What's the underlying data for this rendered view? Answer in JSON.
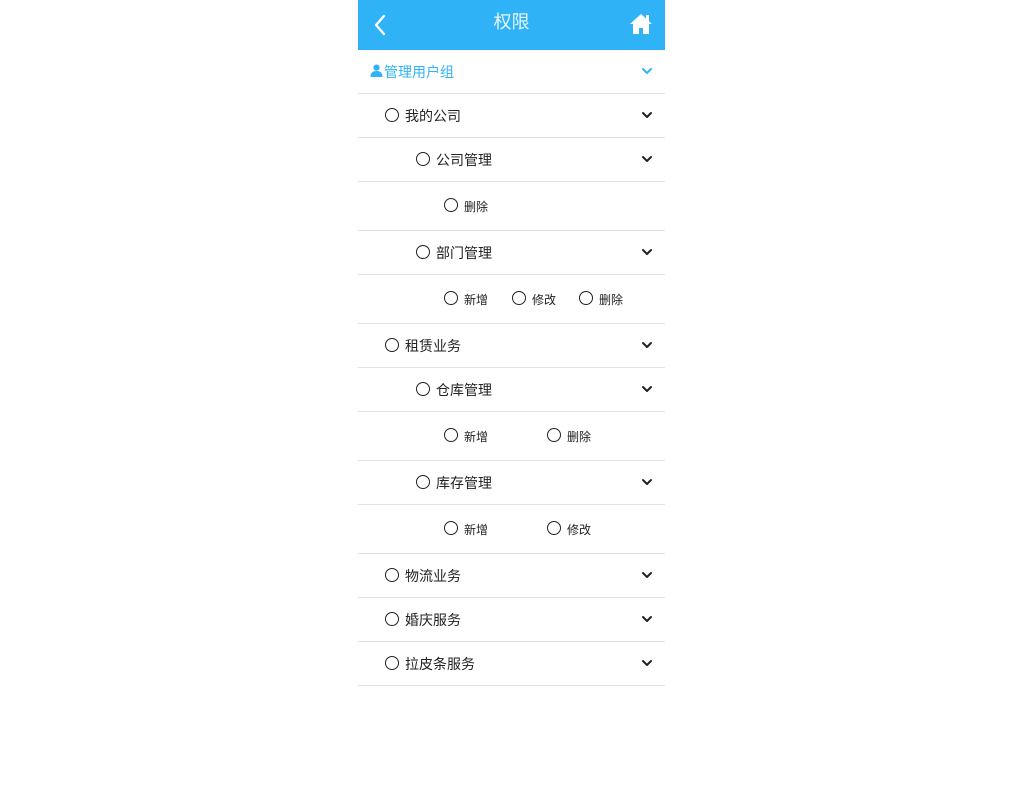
{
  "header": {
    "title": "权限"
  },
  "group": {
    "label": "管理用户组"
  },
  "tree": {
    "my_company": {
      "label": "我的公司",
      "company_mgmt": {
        "label": "公司管理",
        "ops": [
          "删除"
        ]
      },
      "dept_mgmt": {
        "label": "部门管理",
        "ops": [
          "新增",
          "修改",
          "删除"
        ]
      }
    },
    "leasing": {
      "label": "租赁业务",
      "warehouse_mgmt": {
        "label": "仓库管理",
        "ops": [
          "新增",
          "删除"
        ]
      },
      "inventory_mgmt": {
        "label": "库存管理",
        "ops": [
          "新增",
          "修改"
        ]
      }
    },
    "logistics": {
      "label": "物流业务"
    },
    "wedding": {
      "label": "婚庆服务"
    },
    "peel_noodle": {
      "label": "拉皮条服务"
    }
  },
  "colors": {
    "accent": "#2fb3f6",
    "divider": "#e3e3e3",
    "text": "#222222"
  }
}
